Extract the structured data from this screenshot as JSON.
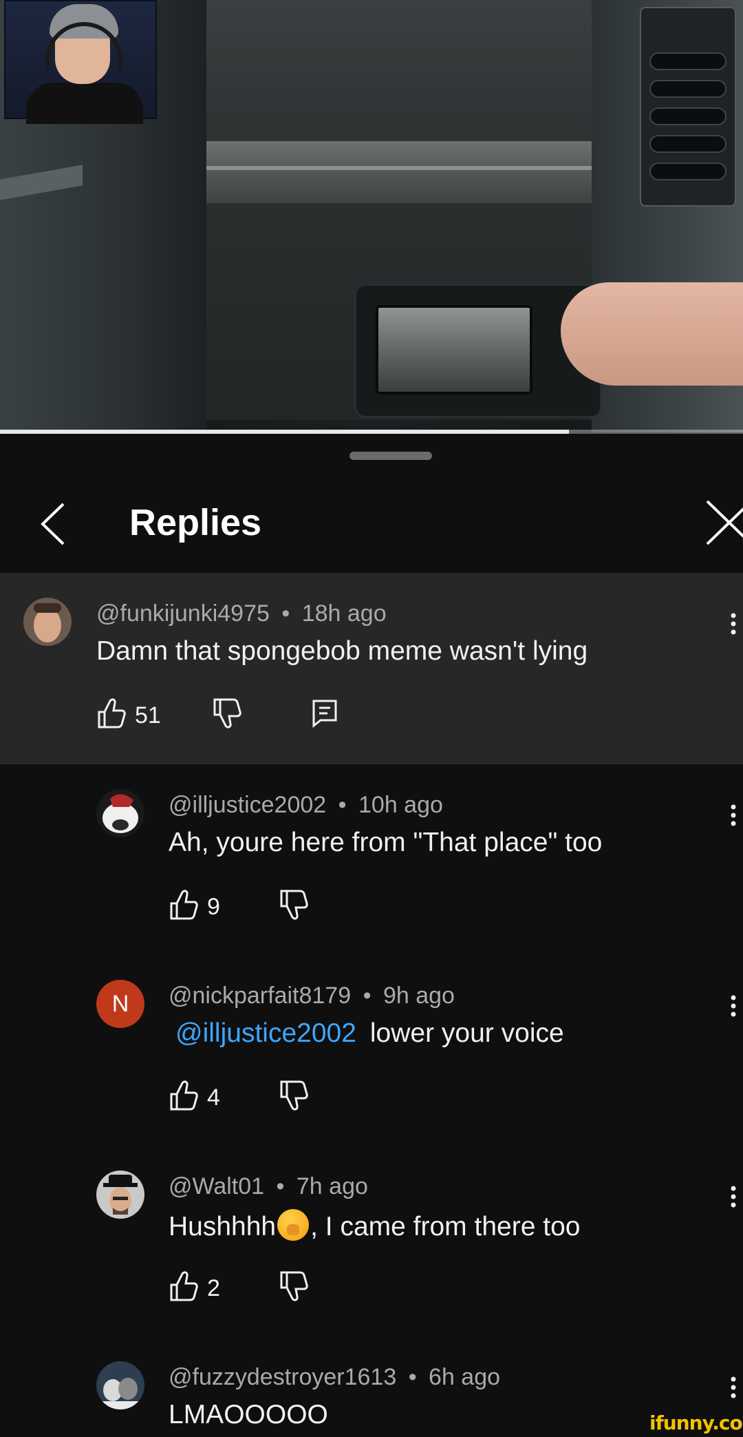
{
  "video": {
    "progress_fraction": 0.766,
    "facecam": true
  },
  "sheet": {
    "title": "Replies"
  },
  "comments": [
    {
      "author": "@funkijunki4975",
      "time": "18h ago",
      "text": "Damn that spongebob meme wasn't lying",
      "likes": "51",
      "highlighted": true,
      "has_reply_button": true
    },
    {
      "author": "@illjustice2002",
      "time": "10h ago",
      "text": "Ah, youre here from \"That place\" too",
      "likes": "9"
    },
    {
      "author": "@nickparfait8179",
      "time": "9h ago",
      "mention": "@illjustice2002",
      "text": "lower your voice",
      "likes": "4",
      "avatar_letter": "N",
      "avatar_color": "#c0391b"
    },
    {
      "author": "@Walt01",
      "time": "7h ago",
      "text_before_emoji": "Hushhhh",
      "emoji": "shushing-face",
      "text_after_emoji": ", I came from there too",
      "likes": "2"
    },
    {
      "author": "@fuzzydestroyer1613",
      "time": "6h ago",
      "text": "LMAOOOOO"
    }
  ],
  "separator": "•",
  "watermark": "ifunny.co",
  "colors": {
    "background": "#0f0f0f",
    "highlight": "#272727",
    "mention": "#3ea6ff",
    "meta": "#aaaaaa",
    "watermark": "#f2c200"
  }
}
